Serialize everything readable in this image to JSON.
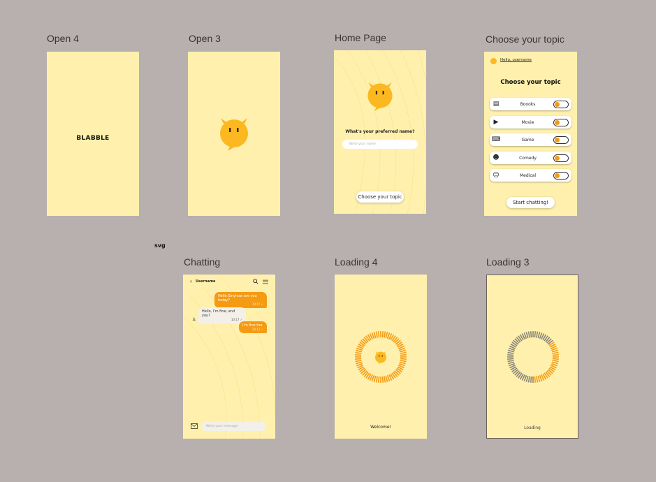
{
  "frames": {
    "open4": {
      "label": "Open 4",
      "brand": "BLABBLE"
    },
    "open3": {
      "label": "Open 3"
    },
    "home": {
      "label": "Home Page",
      "question": "What's your preferred name?",
      "name_placeholder": "Write your name",
      "cta": "Choose your topic"
    },
    "topic": {
      "label": "Choose your topic",
      "greeting": "Hello, username",
      "heading": "Choose your topic",
      "topics": [
        {
          "label": "Boooks",
          "icon": "book-icon"
        },
        {
          "label": "Movie",
          "icon": "movie-icon"
        },
        {
          "label": "Game",
          "icon": "gamepad-icon"
        },
        {
          "label": "Comedy",
          "icon": "comedy-icon"
        },
        {
          "label": "Medical",
          "icon": "medical-icon"
        }
      ],
      "cta": "Start chatting!"
    },
    "chat": {
      "label": "Chatting",
      "username": "Username",
      "messages": [
        {
          "text": "Hello Sinyhow are you today?",
          "time": "10:17 ✓"
        },
        {
          "text": "Hello, I'm fine, and you?",
          "time": "10:17 ✓"
        },
        {
          "text": "I'm fine tne",
          "time": "10:17 ✓"
        }
      ],
      "input_placeholder": "Write your message"
    },
    "loading4": {
      "label": "Loading 4",
      "caption": "Welcome!",
      "progress": 1.0
    },
    "loading3": {
      "label": "Loading 3",
      "caption": "Loading",
      "progress": 0.35
    }
  },
  "stray_label": "svg",
  "colors": {
    "canvas": "#b8afaf",
    "screen": "#fff1ad",
    "accent": "#f59a13",
    "mascot": "#fbb820",
    "ring_inactive": "#8a8478"
  }
}
